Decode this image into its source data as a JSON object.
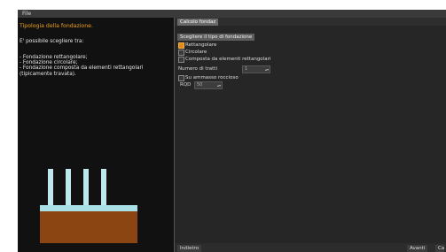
{
  "menubar": {
    "file_label": "File"
  },
  "info": {
    "title": "Tipologia della fondazione.",
    "intro": "E' possibile scegliere tra:",
    "lines": [
      "- Fondazione rettangolare;",
      "- Fondazione circolare;",
      "- Fondazione composta da elementi rettangolari",
      "(tipicamente travata)."
    ]
  },
  "tabs": {
    "active_label": "Calcolo fondaz"
  },
  "foundation": {
    "group_title": "Scegliere il tipo di fondazione",
    "options": [
      "Rettangolare",
      "Circolare",
      "Composta da elementi rettangolari"
    ],
    "selected": "Rettangolare",
    "num_tratti_label": "Numero di tratti",
    "num_tratti_value": "1",
    "rock_checkbox_label": "Su ammasso roccioso",
    "rqd_label": "RQD",
    "rqd_value": "50"
  },
  "nav": {
    "back_label": "Indietro",
    "next_label": "Avanti",
    "extra_label": "Ca"
  },
  "colors": {
    "accent": "#f0a020",
    "pile": "#bde8ee",
    "base": "#8b4513",
    "cap": "#a9e0e6"
  }
}
